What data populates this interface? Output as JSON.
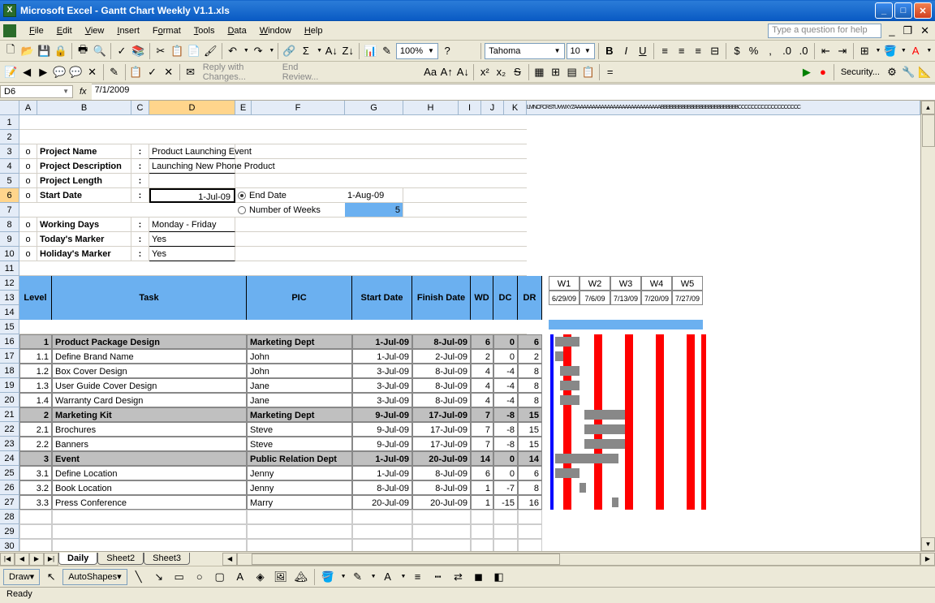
{
  "app": {
    "title": "Microsoft Excel - Gantt Chart Weekly V1.1.xls"
  },
  "menu": {
    "file": "File",
    "edit": "Edit",
    "view": "View",
    "insert": "Insert",
    "format": "Format",
    "tools": "Tools",
    "data": "Data",
    "window": "Window",
    "help": "Help",
    "helpbox": "Type a question for help"
  },
  "toolbar": {
    "font": "Tahoma",
    "size": "10",
    "zoom": "100%",
    "reply": "Reply with Changes...",
    "endreview": "End Review...",
    "security": "Security..."
  },
  "formula": {
    "cell": "D6",
    "value": "7/1/2009"
  },
  "project": {
    "name_lbl": "Project Name",
    "name_val": "Product Launching Event",
    "desc_lbl": "Project Description",
    "desc_val": "Launching New Phone Product",
    "length_lbl": "Project Length",
    "start_lbl": "Start Date",
    "start_val": "1-Jul-09",
    "end_lbl": "End Date",
    "end_val": "1-Aug-09",
    "weeks_lbl": "Number of Weeks",
    "weeks_val": "5",
    "working_lbl": "Working Days",
    "working_val": "Monday - Friday",
    "today_lbl": "Today's Marker",
    "today_val": "Yes",
    "holiday_lbl": "Holiday's Marker",
    "holiday_val": "Yes",
    "colon": ":"
  },
  "headers": {
    "level": "Level",
    "task": "Task",
    "pic": "PIC",
    "start": "Start Date",
    "finish": "Finish Date",
    "wd": "WD",
    "dc": "DC",
    "dr": "DR"
  },
  "weeks": [
    {
      "w": "W1",
      "d": "6/29/09"
    },
    {
      "w": "W2",
      "d": "7/6/09"
    },
    {
      "w": "W3",
      "d": "7/13/09"
    },
    {
      "w": "W4",
      "d": "7/20/09"
    },
    {
      "w": "W5",
      "d": "7/27/09"
    }
  ],
  "rows": [
    {
      "lvl": "1",
      "task": "Product Package Design",
      "pic": "Marketing Dept",
      "s": "1-Jul-09",
      "f": "8-Jul-09",
      "wd": "6",
      "dc": "0",
      "dr": "6",
      "hdr": true
    },
    {
      "lvl": "1.1",
      "task": "Define Brand Name",
      "pic": "John",
      "s": "1-Jul-09",
      "f": "2-Jul-09",
      "wd": "2",
      "dc": "0",
      "dr": "2",
      "hdr": false
    },
    {
      "lvl": "1.2",
      "task": "Box Cover Design",
      "pic": "John",
      "s": "3-Jul-09",
      "f": "8-Jul-09",
      "wd": "4",
      "dc": "-4",
      "dr": "8",
      "hdr": false
    },
    {
      "lvl": "1.3",
      "task": "User Guide Cover Design",
      "pic": "Jane",
      "s": "3-Jul-09",
      "f": "8-Jul-09",
      "wd": "4",
      "dc": "-4",
      "dr": "8",
      "hdr": false
    },
    {
      "lvl": "1.4",
      "task": "Warranty Card Design",
      "pic": "Jane",
      "s": "3-Jul-09",
      "f": "8-Jul-09",
      "wd": "4",
      "dc": "-4",
      "dr": "8",
      "hdr": false
    },
    {
      "lvl": "2",
      "task": "Marketing Kit",
      "pic": "Marketing Dept",
      "s": "9-Jul-09",
      "f": "17-Jul-09",
      "wd": "7",
      "dc": "-8",
      "dr": "15",
      "hdr": true
    },
    {
      "lvl": "2.1",
      "task": "Brochures",
      "pic": "Steve",
      "s": "9-Jul-09",
      "f": "17-Jul-09",
      "wd": "7",
      "dc": "-8",
      "dr": "15",
      "hdr": false
    },
    {
      "lvl": "2.2",
      "task": "Banners",
      "pic": "Steve",
      "s": "9-Jul-09",
      "f": "17-Jul-09",
      "wd": "7",
      "dc": "-8",
      "dr": "15",
      "hdr": false
    },
    {
      "lvl": "3",
      "task": "Event",
      "pic": "Public Relation Dept",
      "s": "1-Jul-09",
      "f": "20-Jul-09",
      "wd": "14",
      "dc": "0",
      "dr": "14",
      "hdr": true
    },
    {
      "lvl": "3.1",
      "task": "Define Location",
      "pic": "Jenny",
      "s": "1-Jul-09",
      "f": "8-Jul-09",
      "wd": "6",
      "dc": "0",
      "dr": "6",
      "hdr": false
    },
    {
      "lvl": "3.2",
      "task": "Book Location",
      "pic": "Jenny",
      "s": "8-Jul-09",
      "f": "8-Jul-09",
      "wd": "1",
      "dc": "-7",
      "dr": "8",
      "hdr": false
    },
    {
      "lvl": "3.3",
      "task": "Press Conference",
      "pic": "Marry",
      "s": "20-Jul-09",
      "f": "20-Jul-09",
      "wd": "1",
      "dc": "-15",
      "dr": "16",
      "hdr": false
    }
  ],
  "tabs": {
    "t1": "Daily",
    "t2": "Sheet2",
    "t3": "Sheet3"
  },
  "draw": {
    "label": "Draw",
    "autoshapes": "AutoShapes"
  },
  "status": {
    "ready": "Ready"
  },
  "cols": [
    "A",
    "B",
    "C",
    "D",
    "E",
    "F",
    "G",
    "H",
    "I",
    "J",
    "K"
  ],
  "chart_data": {
    "type": "bar",
    "title": "Gantt Chart Weekly",
    "xlabel": "Week",
    "ylabel": "Task",
    "categories": [
      "W1 6/29/09",
      "W2 7/6/09",
      "W3 7/13/09",
      "W4 7/20/09",
      "W5 7/27/09"
    ],
    "series": [
      {
        "name": "Product Package Design",
        "start": "1-Jul-09",
        "end": "8-Jul-09"
      },
      {
        "name": "Define Brand Name",
        "start": "1-Jul-09",
        "end": "2-Jul-09"
      },
      {
        "name": "Box Cover Design",
        "start": "3-Jul-09",
        "end": "8-Jul-09"
      },
      {
        "name": "User Guide Cover Design",
        "start": "3-Jul-09",
        "end": "8-Jul-09"
      },
      {
        "name": "Warranty Card Design",
        "start": "3-Jul-09",
        "end": "8-Jul-09"
      },
      {
        "name": "Marketing Kit",
        "start": "9-Jul-09",
        "end": "17-Jul-09"
      },
      {
        "name": "Brochures",
        "start": "9-Jul-09",
        "end": "17-Jul-09"
      },
      {
        "name": "Banners",
        "start": "9-Jul-09",
        "end": "17-Jul-09"
      },
      {
        "name": "Event",
        "start": "1-Jul-09",
        "end": "20-Jul-09"
      },
      {
        "name": "Define Location",
        "start": "1-Jul-09",
        "end": "8-Jul-09"
      },
      {
        "name": "Book Location",
        "start": "8-Jul-09",
        "end": "8-Jul-09"
      },
      {
        "name": "Press Conference",
        "start": "20-Jul-09",
        "end": "20-Jul-09"
      }
    ]
  }
}
